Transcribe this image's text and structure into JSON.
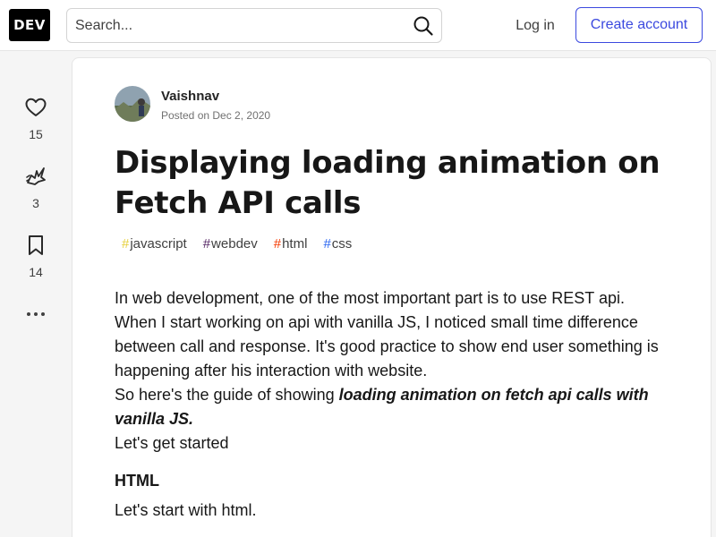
{
  "header": {
    "logo": "DEV",
    "search_placeholder": "Search...",
    "login_label": "Log in",
    "create_account_label": "Create account"
  },
  "sidebar": {
    "reactions": [
      {
        "icon": "heart-icon",
        "count": "15"
      },
      {
        "icon": "unicorn-icon",
        "count": "3"
      },
      {
        "icon": "bookmark-icon",
        "count": "14"
      },
      {
        "icon": "more-horizontal-icon"
      }
    ]
  },
  "article": {
    "author": "Vaishnav",
    "posted": "Posted on Dec 2, 2020",
    "title": "Displaying loading animation on Fetch API calls",
    "tags": [
      {
        "name": "javascript",
        "color": "#e6d03a"
      },
      {
        "name": "webdev",
        "color": "#562765"
      },
      {
        "name": "html",
        "color": "#f53900"
      },
      {
        "name": "css",
        "color": "#2965f1"
      }
    ],
    "paragraph1": "In web development, one of the most important part is to use REST api. When I start working on api with vanilla JS, I noticed small time difference between call and response. It's good practice to show end user something is happening after his interaction with website.",
    "paragraph2_prefix": "So here's the guide of showing ",
    "paragraph2_bold": "loading animation on fetch api calls with vanilla JS.",
    "paragraph3": "Let's get started",
    "heading_html": "HTML",
    "paragraph4": "Let's start with html."
  },
  "colors": {
    "accent": "#3b49df",
    "background": "#f5f5f5"
  }
}
